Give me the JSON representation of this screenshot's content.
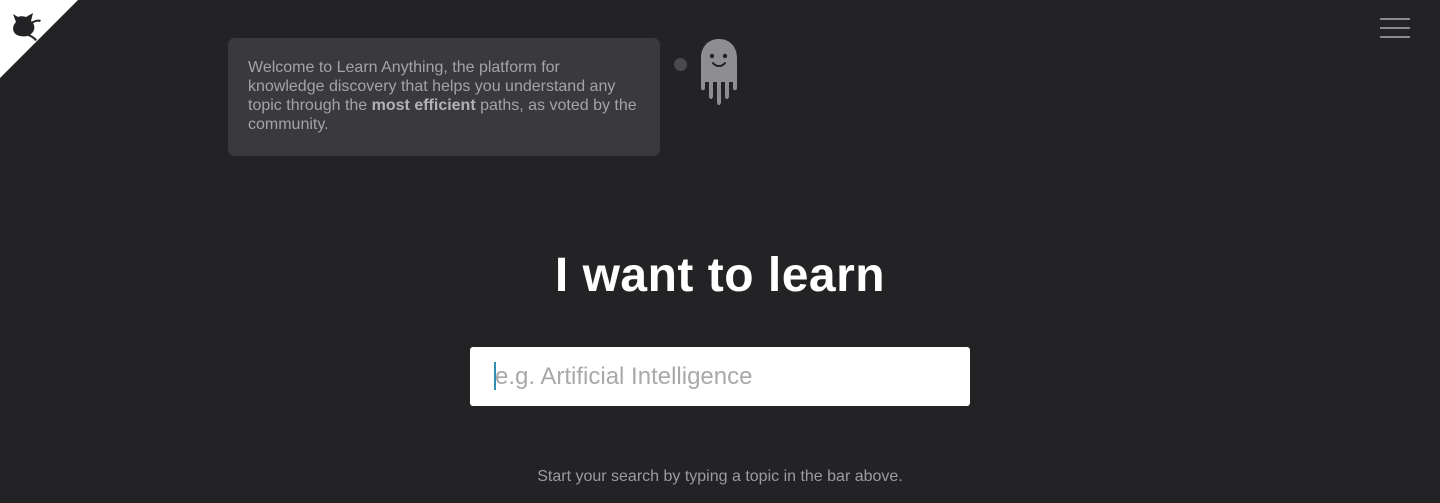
{
  "welcome": {
    "text_before": "Welcome to Learn Anything, the platform for knowledge discovery that helps you understand any topic through the ",
    "text_bold": "most efficient",
    "text_after": " paths, as voted by the community."
  },
  "hero": {
    "title": "I want to learn"
  },
  "search": {
    "placeholder": "e.g. Artificial Intelligence",
    "value": ""
  },
  "hint": {
    "text": "Start your search by typing a topic in the bar above."
  },
  "icons": {
    "corner": "github-octocat-icon",
    "menu": "hamburger-menu-icon",
    "mascot": "ghost-mascot-icon"
  },
  "colors": {
    "background": "#232225",
    "bubble": "#3a393c",
    "title": "#ffffff",
    "corner": "#ffffff"
  }
}
